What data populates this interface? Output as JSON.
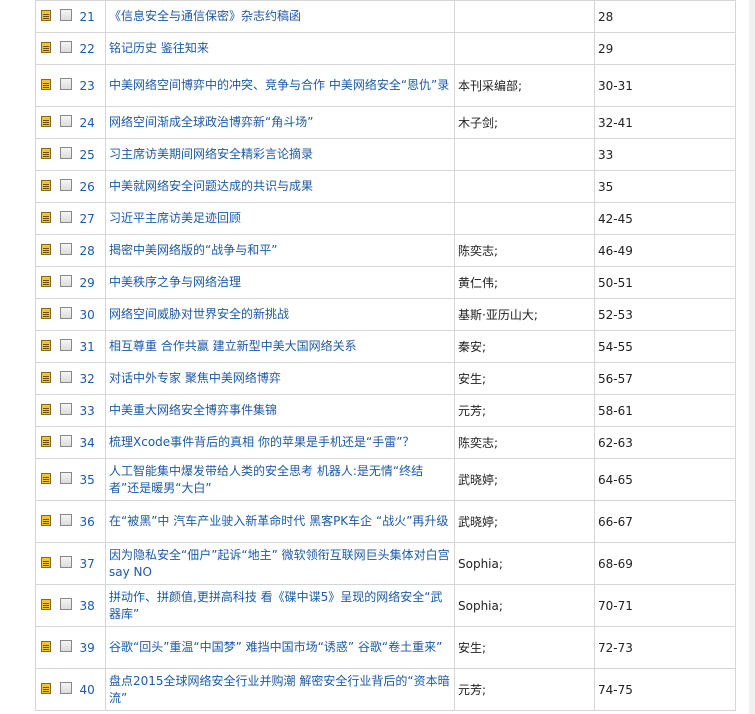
{
  "rows": [
    {
      "num": "21",
      "title": "《信息安全与通信保密》杂志约稿函",
      "author": "",
      "pages": "28"
    },
    {
      "num": "22",
      "title": "铭记历史 鉴往知来",
      "author": "",
      "pages": "29"
    },
    {
      "num": "23",
      "title": "中美网络空间博弈中的冲突、竞争与合作 中美网络安全“恩仇”录",
      "author": "本刊采编部;",
      "pages": "30-31"
    },
    {
      "num": "24",
      "title": "网络空间渐成全球政治博弈新“角斗场”",
      "author": "木子剑;",
      "pages": "32-41"
    },
    {
      "num": "25",
      "title": "习主席访美期间网络安全精彩言论摘录",
      "author": "",
      "pages": "33"
    },
    {
      "num": "26",
      "title": "中美就网络安全问题达成的共识与成果",
      "author": "",
      "pages": "35"
    },
    {
      "num": "27",
      "title": "习近平主席访美足迹回顾",
      "author": "",
      "pages": "42-45"
    },
    {
      "num": "28",
      "title": "揭密中美网络版的“战争与和平”",
      "author": "陈奕志;",
      "pages": "46-49"
    },
    {
      "num": "29",
      "title": "中美秩序之争与网络治理",
      "author": "黄仁伟;",
      "pages": "50-51"
    },
    {
      "num": "30",
      "title": "网络空间威胁对世界安全的新挑战",
      "author": "基斯·亚历山大;",
      "pages": "52-53"
    },
    {
      "num": "31",
      "title": "相互尊重 合作共赢 建立新型中美大国网络关系",
      "author": "秦安;",
      "pages": "54-55"
    },
    {
      "num": "32",
      "title": "对话中外专家 聚焦中美网络博弈",
      "author": "安生;",
      "pages": "56-57"
    },
    {
      "num": "33",
      "title": "中美重大网络安全博弈事件集锦",
      "author": "元芳;",
      "pages": "58-61"
    },
    {
      "num": "34",
      "title": "梳理Xcode事件背后的真相 你的苹果是手机还是“手雷”？",
      "author": "陈奕志;",
      "pages": "62-63"
    },
    {
      "num": "35",
      "title": "人工智能集中爆发带给人类的安全思考 机器人:是无情“终结者”还是暖男“大白”",
      "author": "武晓婷;",
      "pages": "64-65"
    },
    {
      "num": "36",
      "title": "在“被黑”中 汽车产业驶入新革命时代 黑客PK车企 “战火”再升级",
      "author": "武晓婷;",
      "pages": "66-67"
    },
    {
      "num": "37",
      "title": "因为隐私安全“佃户”起诉“地主” 微软领衔互联网巨头集体对白宫say NO",
      "author": "Sophia;",
      "pages": "68-69"
    },
    {
      "num": "38",
      "title": "拼动作、拼颜值,更拼高科技 看《碟中谍5》呈现的网络安全“武器库”",
      "author": "Sophia;",
      "pages": "70-71"
    },
    {
      "num": "39",
      "title": "谷歌“回头”重温“中国梦” 难挡中国市场“诱惑” 谷歌“卷土重来”",
      "author": "安生;",
      "pages": "72-73"
    },
    {
      "num": "40",
      "title": "盘点2015全球网络安全行业并购潮 解密安全行业背后的“资本暗流”",
      "author": "元芳;",
      "pages": "74-75"
    }
  ]
}
